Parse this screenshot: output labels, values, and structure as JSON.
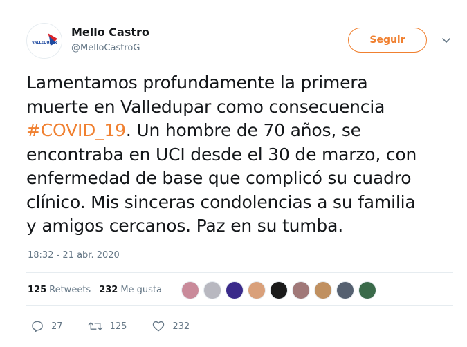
{
  "author": {
    "name": "Mello Castro",
    "handle": "@MelloCastroG",
    "avatar_text": "VALLEDUPAR"
  },
  "follow_button": {
    "label": "Seguir"
  },
  "tweet": {
    "lines": [
      [
        "Lamentamos profundamente la primera"
      ],
      [
        "muerte en Valledupar como consecuencia"
      ],
      [
        "#COVID_19",
        ". Un hombre de 70 años, se"
      ],
      [
        "encontraba en UCI desde el 30 de marzo, con"
      ],
      [
        "enfermedad de base que complicó su cuadro"
      ],
      [
        "clínico. Mis sinceras condolencias a su familia"
      ],
      [
        "y amigos cercanos. Paz en su tumba."
      ]
    ],
    "timestamp": "18:32 - 21 abr. 2020"
  },
  "stats": {
    "retweets_count": "125",
    "retweets_label": "Retweets",
    "likes_count": "232",
    "likes_label": "Me gusta"
  },
  "liker_avatar_colors": [
    "#c98a9a",
    "#b8b8c0",
    "#3a2a8a",
    "#d9a07a",
    "#1a1a1a",
    "#a07878",
    "#c09060",
    "#556070",
    "#3a6a4a"
  ],
  "actions": {
    "reply_count": "27",
    "retweet_count": "125",
    "like_count": "232"
  },
  "colors": {
    "accent": "#f08030",
    "secondary_text": "#657786",
    "primary_text": "#14171a"
  }
}
